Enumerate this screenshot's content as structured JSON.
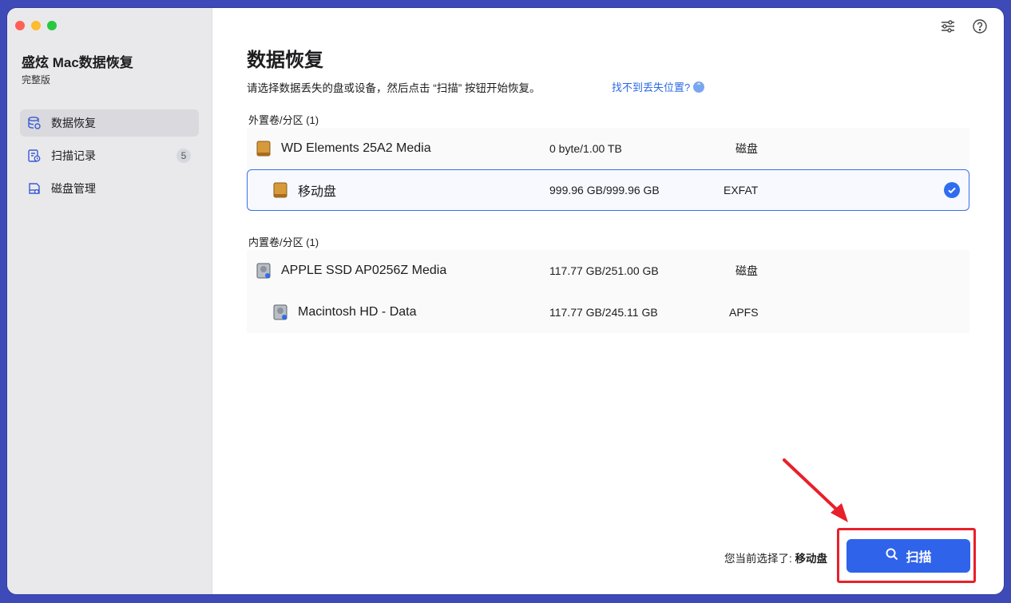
{
  "window": {
    "controls": [
      "close",
      "minimize",
      "zoom"
    ]
  },
  "sidebar": {
    "app_title": "盛炫 Mac数据恢复",
    "edition": "完整版",
    "items": [
      {
        "label": "数据恢复",
        "icon": "database-icon",
        "active": true
      },
      {
        "label": "扫描记录",
        "icon": "scan-history-icon",
        "badge": "5"
      },
      {
        "label": "磁盘管理",
        "icon": "disk-manage-icon"
      }
    ]
  },
  "header": {
    "title": "数据恢复",
    "subtitle": "请选择数据丢失的盘或设备，然后点击 “扫描” 按钮开始恢复。",
    "help_link": "找不到丢失位置?",
    "icons": [
      "settings-sliders-icon",
      "help-icon"
    ]
  },
  "external": {
    "label": "外置卷/分区 (1)",
    "rows": [
      {
        "name": "WD Elements 25A2 Media",
        "size": "0 byte/1.00 TB",
        "fs": "磁盘",
        "level": 0
      },
      {
        "name": "移动盘",
        "size": "999.96 GB/999.96 GB",
        "fs": "EXFAT",
        "level": 1,
        "selected": true
      }
    ]
  },
  "internal": {
    "label": "内置卷/分区 (1)",
    "rows": [
      {
        "name": "APPLE SSD AP0256Z Media",
        "size": "117.77 GB/251.00 GB",
        "fs": "磁盘",
        "level": 0
      },
      {
        "name": "Macintosh HD - Data",
        "size": "117.77 GB/245.11 GB",
        "fs": "APFS",
        "level": 1
      }
    ]
  },
  "footer": {
    "selected_prefix": "您当前选择了: ",
    "selected_value": "移动盘",
    "scan_label": "扫描"
  },
  "colors": {
    "accent": "#2f63ea",
    "highlight": "#e8202a",
    "background": "#3d4ab8"
  }
}
